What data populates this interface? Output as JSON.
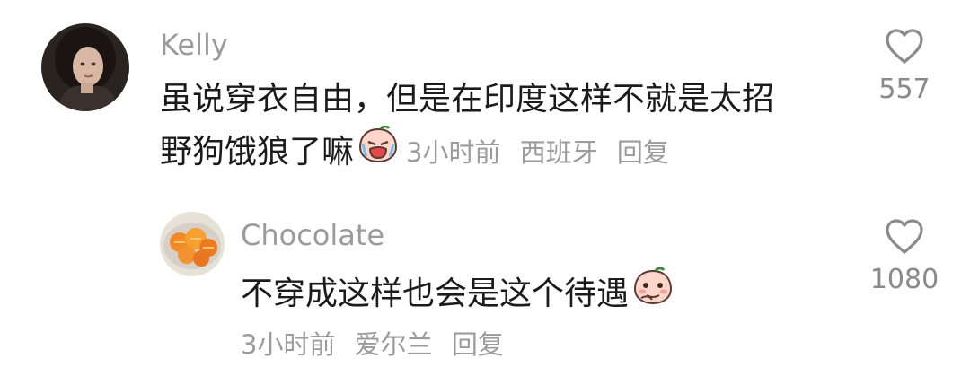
{
  "comments": [
    {
      "username": "Kelly",
      "text_line1": "虽说穿衣自由，但是在印度这样不就是太招",
      "text_line2": "野狗饿狼了嘛",
      "time": "3小时前",
      "location": "西班牙",
      "reply_label": "回复",
      "like_count": "557",
      "emoji": "crying-face-emoji"
    },
    {
      "username": "Chocolate",
      "text": "不穿成这样也会是这个待遇",
      "time": "3小时前",
      "location": "爱尔兰",
      "reply_label": "回复",
      "like_count": "1080",
      "emoji": "shy-face-emoji"
    }
  ]
}
